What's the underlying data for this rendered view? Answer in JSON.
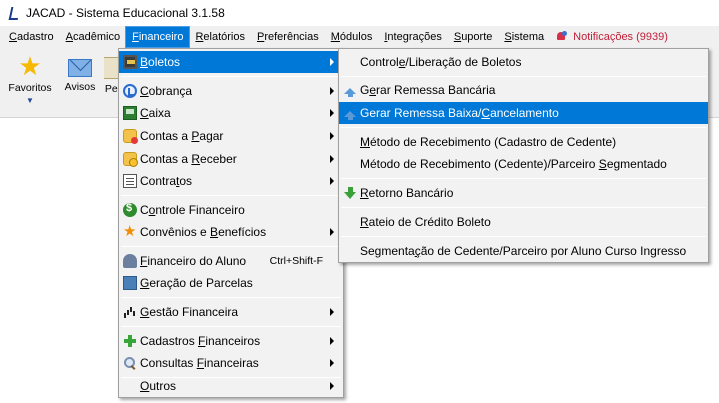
{
  "window": {
    "title": "JACAD - Sistema Educacional 3.1.58"
  },
  "menubar": {
    "items": [
      {
        "u": "C",
        "rest": "adastro"
      },
      {
        "u": "A",
        "rest": "cadêmico"
      },
      {
        "u": "F",
        "rest": "inanceiro"
      },
      {
        "u": "R",
        "rest": "elatórios"
      },
      {
        "u": "P",
        "rest": "referências"
      },
      {
        "u": "M",
        "rest": "ódulos"
      },
      {
        "u": "I",
        "rest": "ntegrações"
      },
      {
        "u": "S",
        "rest": "uporte"
      },
      {
        "u": "S",
        "rest": "istema"
      }
    ],
    "notifications": "Notificações (9939)"
  },
  "toolbar": {
    "favoritos": "Favoritos",
    "avisos": "Avisos",
    "cut_label": "Per"
  },
  "financeiro_menu": {
    "items": [
      {
        "u": "B",
        "rest": "oletos",
        "icon": "boletos-icon"
      },
      {
        "u": "C",
        "rest": "obrança",
        "icon": "cobranca-icon"
      },
      {
        "u": "C",
        "rest": "aixa",
        "icon": "caixa-icon"
      },
      {
        "pre": "Contas a ",
        "u": "P",
        "rest": "agar",
        "icon": "contas-pagar-icon"
      },
      {
        "pre": "Contas a ",
        "u": "R",
        "rest": "eceber",
        "icon": "contas-receber-icon"
      },
      {
        "pre": "Contra",
        "u": "t",
        "rest": "os",
        "icon": "contratos-icon"
      },
      {
        "pre": "C",
        "u": "o",
        "rest": "ntrole Financeiro",
        "icon": "controle-financeiro-icon"
      },
      {
        "pre": "Convênios e ",
        "u": "B",
        "rest": "enefícios",
        "icon": "convenios-icon"
      },
      {
        "u": "F",
        "rest": "inanceiro do Aluno",
        "shortcut": "Ctrl+Shift-F",
        "icon": "financeiro-aluno-icon"
      },
      {
        "u": "G",
        "rest": "eração de Parcelas",
        "icon": "geracao-parcelas-icon"
      },
      {
        "u": "G",
        "rest": "estão Financeira",
        "icon": "gestao-financeira-icon"
      },
      {
        "pre": "Cadastros ",
        "u": "F",
        "rest": "inanceiros",
        "icon": "cadastros-financeiros-icon"
      },
      {
        "pre": "Consultas ",
        "u": "F",
        "rest": "inanceiras",
        "icon": "consultas-financeiras-icon"
      },
      {
        "u": "O",
        "rest": "utros",
        "icon": ""
      }
    ]
  },
  "boletos_menu": {
    "items": [
      {
        "pre": "Control",
        "u": "e",
        "rest": "/Liberação de Boletos"
      },
      {
        "pre": "G",
        "u": "e",
        "rest": "rar Remessa Bancária"
      },
      {
        "pre": "Gerar Remessa Baixa/",
        "u": "C",
        "rest": "ancelamento"
      },
      {
        "u": "M",
        "rest": "étodo de Recebimento (Cadastro de Cedente)"
      },
      {
        "pre": "Método de Recebimento (Cedente)/Parceiro ",
        "u": "S",
        "rest": "egmentado"
      },
      {
        "u": "R",
        "rest": "etorno Bancário"
      },
      {
        "u": "R",
        "rest": "ateio de Crédito Boleto"
      },
      {
        "pre": "Segmenta",
        "u": "ç",
        "rest": "ão de Cedente/Parceiro por Aluno Curso Ingresso"
      }
    ]
  }
}
